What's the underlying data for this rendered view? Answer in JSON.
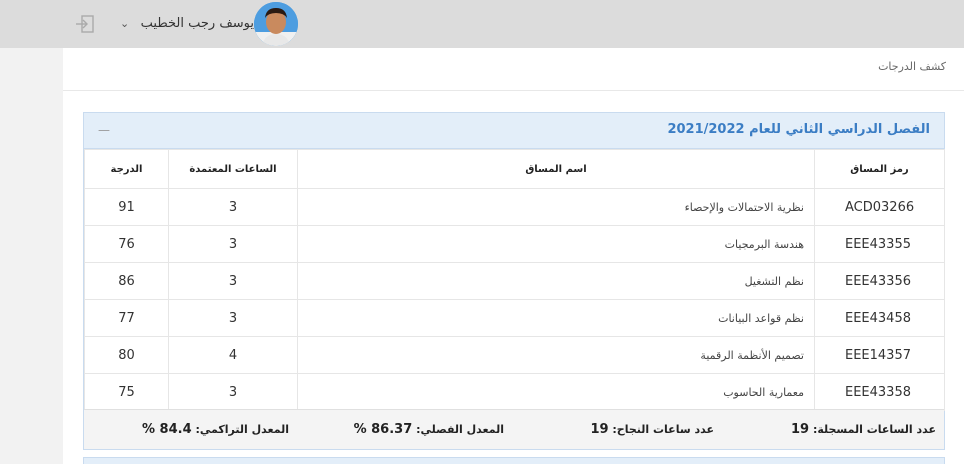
{
  "header": {
    "user_name": "يوسف رجب الخطيب",
    "dropdown_icon": "chevron-down-icon",
    "logout_icon": "logout-icon",
    "avatar_icon": "user-avatar"
  },
  "page": {
    "title": "كشف الدرجات"
  },
  "semester": {
    "title": "الفصل الدراسي الثاني للعام 2021/2022",
    "collapse_label": "—",
    "columns": {
      "code": "رمز المساق",
      "name": "اسم المساق",
      "hours": "الساعات المعتمدة",
      "grade": "الدرجة"
    },
    "rows": [
      {
        "code": "ACD03266",
        "name": "نظرية الاحتمالات والإحصاء",
        "hours": "3",
        "grade": "91"
      },
      {
        "code": "EEE43355",
        "name": "هندسة البرمجيات",
        "hours": "3",
        "grade": "76"
      },
      {
        "code": "EEE43356",
        "name": "نظم التشغيل",
        "hours": "3",
        "grade": "86"
      },
      {
        "code": "EEE43458",
        "name": "نظم قواعد البيانات",
        "hours": "3",
        "grade": "77"
      },
      {
        "code": "EEE14357",
        "name": "تصميم الأنظمة الرقمية",
        "hours": "4",
        "grade": "80"
      },
      {
        "code": "EEE43358",
        "name": "معمارية الحاسوب",
        "hours": "3",
        "grade": "75"
      }
    ],
    "summary": {
      "registered_hours_label": "عدد الساعات المسجلة:",
      "registered_hours": "19",
      "passed_hours_label": "عدد ساعات النجاح:",
      "passed_hours": "19",
      "semester_gpa_label": "المعدل الفصلي:",
      "semester_gpa": "86.37 %",
      "cumulative_gpa_label": "المعدل التراكمي:",
      "cumulative_gpa": "84.4 %"
    }
  },
  "colors": {
    "accent": "#3b7dc4",
    "panel_header": "#e3eef9",
    "topbar": "#dcdcdc"
  }
}
